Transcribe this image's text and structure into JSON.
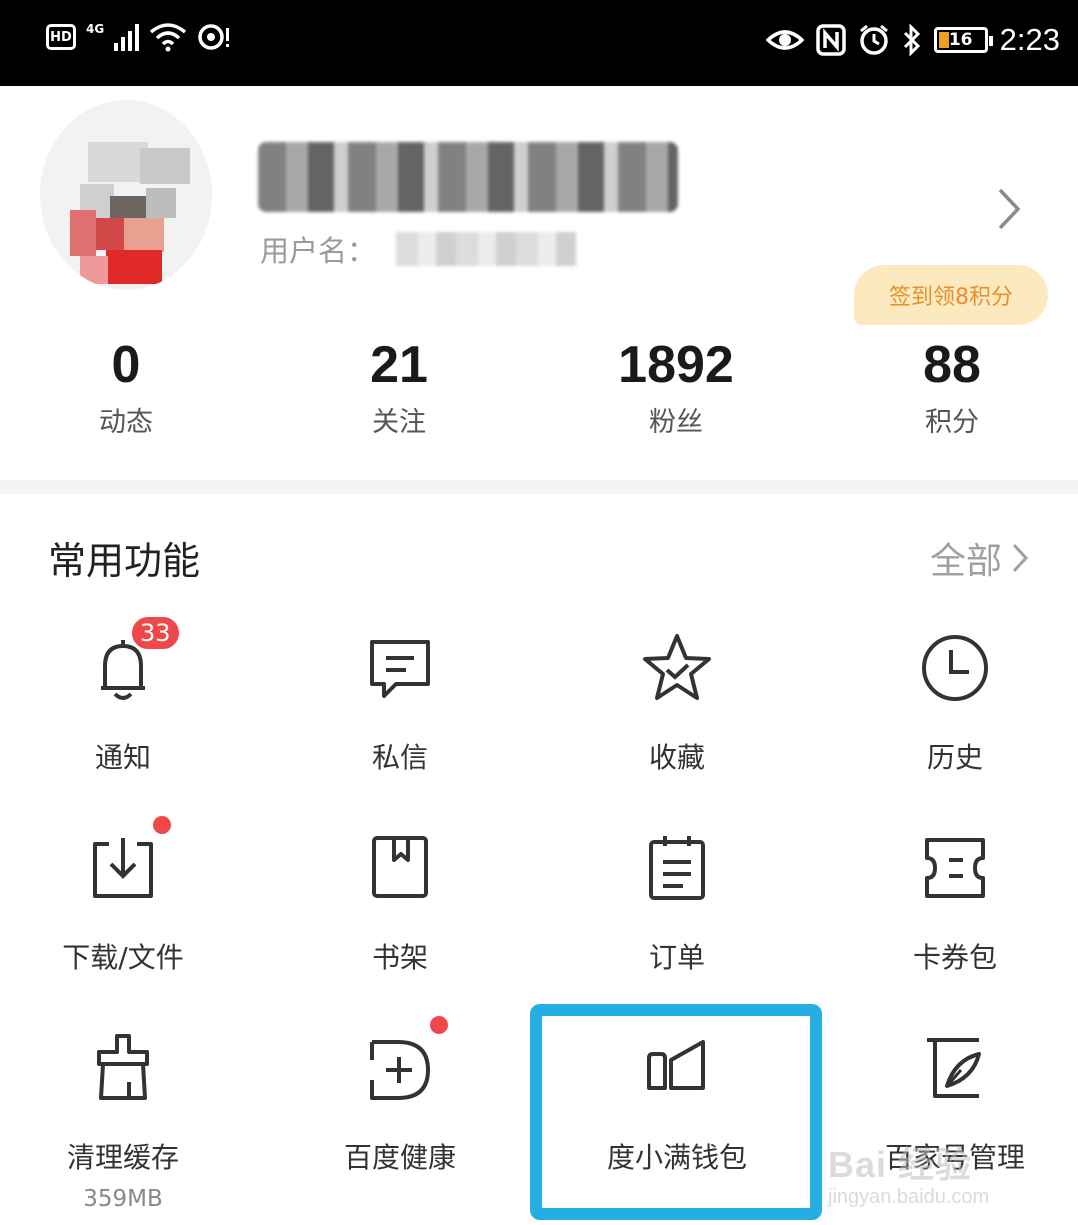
{
  "status_bar": {
    "hd": "HD",
    "network": "4G",
    "battery_level": "16",
    "time": "2:23"
  },
  "profile": {
    "username_label": "用户名："
  },
  "checkin_badge": "签到领8积分",
  "stats": [
    {
      "value": "0",
      "label": "动态"
    },
    {
      "value": "21",
      "label": "关注"
    },
    {
      "value": "1892",
      "label": "粉丝"
    },
    {
      "value": "88",
      "label": "积分"
    }
  ],
  "section": {
    "title": "常用功能",
    "see_all": "全部"
  },
  "grid": {
    "row1": [
      {
        "label": "通知",
        "icon": "bell-icon",
        "badge": "33"
      },
      {
        "label": "私信",
        "icon": "message-icon"
      },
      {
        "label": "收藏",
        "icon": "star-icon"
      },
      {
        "label": "历史",
        "icon": "clock-icon"
      }
    ],
    "row2": [
      {
        "label": "下载/文件",
        "icon": "download-icon",
        "dot": true
      },
      {
        "label": "书架",
        "icon": "bookshelf-icon"
      },
      {
        "label": "订单",
        "icon": "order-icon"
      },
      {
        "label": "卡券包",
        "icon": "ticket-icon"
      }
    ],
    "row3": [
      {
        "label": "清理缓存",
        "sub": "359MB",
        "icon": "broom-icon"
      },
      {
        "label": "百度健康",
        "icon": "health-icon",
        "dot": true
      },
      {
        "label": "度小满钱包",
        "icon": "wallet-icon"
      },
      {
        "label": "百家号管理",
        "icon": "pen-paper-icon"
      }
    ]
  },
  "watermark": {
    "logo": "Bai 经验",
    "url": "jingyan.baidu.com"
  },
  "colors": {
    "badge_red": "#f0484a",
    "checkin_bg": "#fde9c0",
    "checkin_text": "#e8902a",
    "highlight": "#25aee0"
  }
}
